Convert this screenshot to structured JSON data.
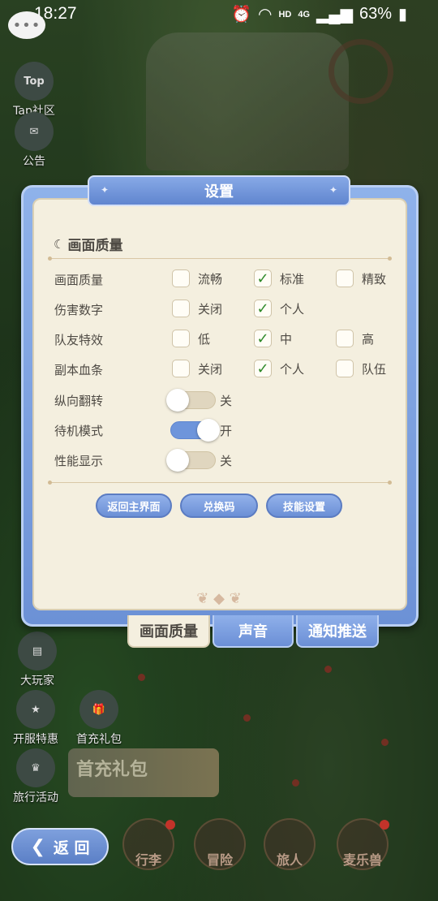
{
  "status_bar": {
    "time": "18:27",
    "network_hd": "HD",
    "network_gen": "4G",
    "battery": "63%"
  },
  "chat_button": {
    "glyph": "•••"
  },
  "side_menu": [
    {
      "icon_text": "Top",
      "label": "Tap社区"
    },
    {
      "icon_text": "✉",
      "label": "公告"
    },
    {
      "icon_text": "▤",
      "label": "大玩家"
    },
    {
      "icon_text": "★",
      "label": "开服特惠"
    },
    {
      "icon_text": "♛",
      "label": "旅行活动"
    }
  ],
  "first_charge": {
    "icon_label": "首充礼包",
    "banner_text": "首充礼包"
  },
  "bottom_nav": {
    "back_label": "返 回",
    "items": [
      "行李",
      "冒险",
      "旅人",
      "麦乐兽"
    ]
  },
  "dialog": {
    "title": "设置",
    "section_title": "画面质量",
    "rows": [
      {
        "label": "画面质量",
        "options": [
          {
            "text": "流畅",
            "checked": false
          },
          {
            "text": "标准",
            "checked": true
          },
          {
            "text": "精致",
            "checked": false
          }
        ]
      },
      {
        "label": "伤害数字",
        "options": [
          {
            "text": "关闭",
            "checked": false
          },
          {
            "text": "个人",
            "checked": true
          }
        ]
      },
      {
        "label": "队友特效",
        "options": [
          {
            "text": "低",
            "checked": false
          },
          {
            "text": "中",
            "checked": true
          },
          {
            "text": "高",
            "checked": false
          }
        ]
      },
      {
        "label": "副本血条",
        "options": [
          {
            "text": "关闭",
            "checked": false
          },
          {
            "text": "个人",
            "checked": true
          },
          {
            "text": "队伍",
            "checked": false
          }
        ]
      }
    ],
    "toggles": [
      {
        "label": "纵向翻转",
        "state": "关",
        "on": false
      },
      {
        "label": "待机模式",
        "state": "开",
        "on": true
      },
      {
        "label": "性能显示",
        "state": "关",
        "on": false
      }
    ],
    "buttons": [
      "返回主界面",
      "兑换码",
      "技能设置"
    ],
    "tabs": [
      "画面质量",
      "声音",
      "通知推送"
    ],
    "check_glyph": "✓"
  },
  "colors": {
    "dialog_blue": "#6c91d6",
    "panel_cream": "#f4efdf",
    "check_green": "#2f8a2a",
    "text_dark": "#4e4a44"
  }
}
